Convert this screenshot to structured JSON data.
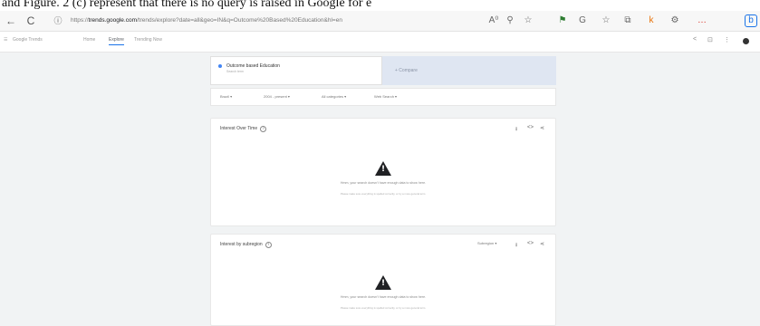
{
  "caption": "and Figure. 2 (c) represent that there is no query is raised in Google for e",
  "browser": {
    "back": "←",
    "reload": "C",
    "url_prefix": "https://",
    "url_domain": "trends.google.com",
    "url_path": "/trends/explore?date=all&geo=IN&q=Outcome%20Based%20Education&hl=en",
    "toolbar_icons": [
      "A⁰",
      "☆",
      "⚑",
      "✦",
      "G",
      "☆",
      "⧉",
      "k",
      "☰",
      "…",
      "b"
    ]
  },
  "app": {
    "title": "Google Trends",
    "tabs": [
      "Home",
      "Explore",
      "Trending Now"
    ],
    "active_tab": "Explore"
  },
  "search_term": {
    "name": "Outcome based Education",
    "subtitle": "Search term"
  },
  "compare_label": "+ Compare",
  "filters": [
    "Brazil ▾",
    "2004 - present ▾",
    "All categories ▾",
    "Web Search ▾"
  ],
  "cards": [
    {
      "title": "Interest Over Time",
      "message": "Hmm, your search doesn't have enough data to show here.",
      "submessage": "Please make sure everything is spelled correctly, or try a more general term.",
      "extra": ""
    },
    {
      "title": "Interest by subregion",
      "message": "Hmm, your search doesn't have enough data to show here.",
      "submessage": "Please make sure everything is spelled correctly, or try a more general term.",
      "extra": "Subregion ▾"
    }
  ],
  "card_actions": [
    "⭳",
    "<>",
    "⋖"
  ],
  "colors": {
    "accent": "#1a73e8",
    "term_dot": "#4285f4",
    "compare_bg": "#dfe6f2"
  }
}
